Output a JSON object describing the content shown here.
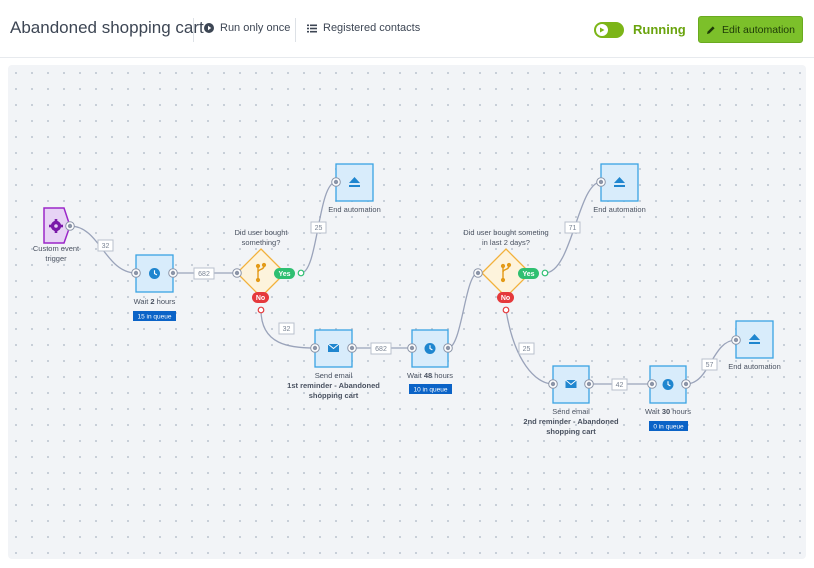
{
  "header": {
    "title": "Abandoned shopping cart",
    "run_only_once": "Run only once",
    "registered_contacts": "Registered contacts",
    "status": "Running",
    "edit_button": "Edit automation"
  },
  "colors": {
    "accent_green": "#7cc02a",
    "status_green": "#6aa40e",
    "node_blue": "#3aa3e3",
    "trigger_purple": "#9b27c9",
    "condition_orange": "#f2b13b",
    "yes_green": "#2fbf71",
    "no_red": "#e5393c",
    "queue_blue": "#0b63c7"
  },
  "flow": {
    "trigger": {
      "line1": "Custom event",
      "line2": "trigger",
      "icon": "gear-icon"
    },
    "wait1": {
      "prefix": "Wait",
      "value": "2",
      "unit": "hours",
      "queue": "15 in queue",
      "icon": "clock-icon"
    },
    "cond1": {
      "line1": "Did user bought",
      "line2": "something?",
      "yes": "Yes",
      "no": "No",
      "icon": "branch-icon"
    },
    "end1": {
      "label": "End automation",
      "icon": "eject-icon"
    },
    "email1": {
      "line1": "Send email",
      "line2": "1st reminder - Abandoned",
      "line3": "shopping cart",
      "icon": "envelope-icon"
    },
    "wait2": {
      "prefix": "Wait",
      "value": "48",
      "unit": "hours",
      "queue": "10 in queue",
      "icon": "clock-icon"
    },
    "cond2": {
      "line1": "Did user bought someting",
      "line2": "in last 2 days?",
      "yes": "Yes",
      "no": "No",
      "icon": "branch-icon"
    },
    "end2": {
      "label": "End automation",
      "icon": "eject-icon"
    },
    "email2": {
      "line1": "Send email",
      "line2": "2nd reminder - Abandoned",
      "line3": "shopping cart",
      "icon": "envelope-icon"
    },
    "wait3": {
      "prefix": "Wait",
      "value": "30",
      "unit": "hours",
      "queue": "0 in queue",
      "icon": "clock-icon"
    },
    "end3": {
      "label": "End automation",
      "icon": "eject-icon"
    },
    "counts": {
      "trigger_to_wait1": "32",
      "wait1_to_cond1": "682",
      "cond1_yes_to_end1": "25",
      "cond1_no_to_email1": "32",
      "email1_to_wait2": "682",
      "cond2_yes_to_end2": "71",
      "cond2_no_to_email2": "25",
      "email2_to_wait3": "42",
      "wait3_to_end3": "57"
    }
  }
}
